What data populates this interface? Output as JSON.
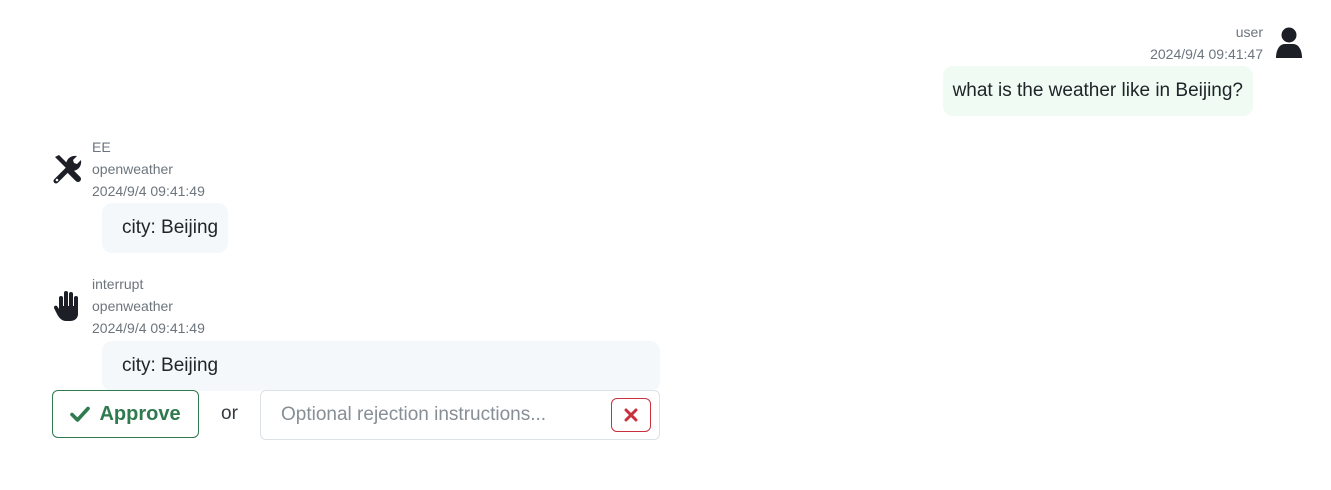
{
  "user_message": {
    "sender": "user",
    "timestamp": "2024/9/4 09:41:47",
    "text": "what is the weather like in Beijing?",
    "icon": "user-icon"
  },
  "tool_call": {
    "label": "EE",
    "tool": "openweather",
    "timestamp": "2024/9/4 09:41:49",
    "text": "city: Beijing",
    "icon": "tools-icon"
  },
  "interrupt": {
    "label": "interrupt",
    "tool": "openweather",
    "timestamp": "2024/9/4 09:41:49",
    "text": "city: Beijing",
    "icon": "hand-icon"
  },
  "actions": {
    "approve_label": "Approve",
    "or_label": "or",
    "reject_placeholder": "Optional rejection instructions...",
    "approve_icon": "check-icon",
    "reject_icon": "x-icon"
  },
  "colors": {
    "approve": "#2f7a4f",
    "reject": "#c9303e",
    "user_bubble": "#effbf3",
    "tool_bubble": "#f5f8fb"
  }
}
